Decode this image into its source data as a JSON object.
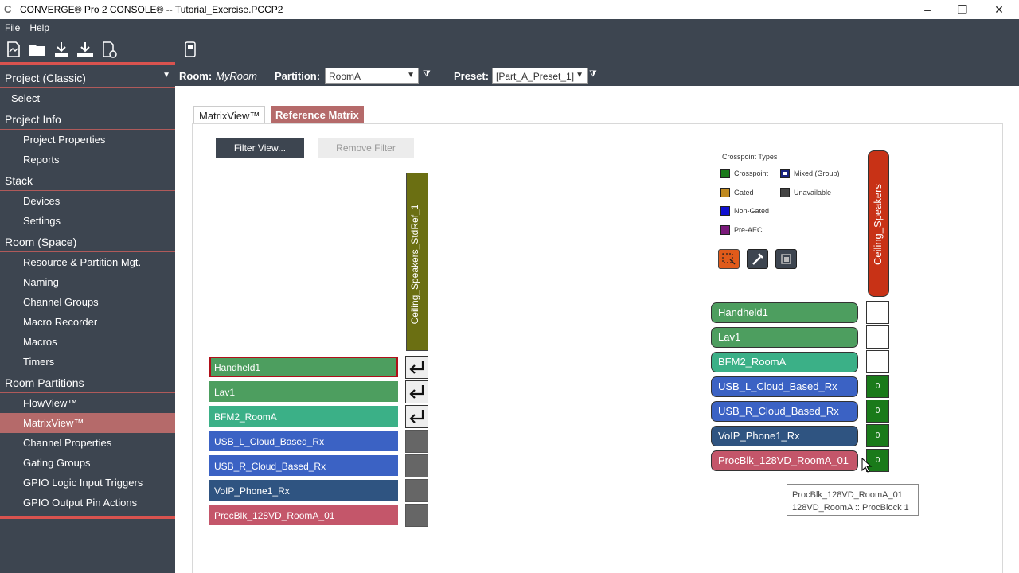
{
  "window": {
    "title": "CONVERGE® Pro 2 CONSOLE®  -- Tutorial_Exercise.PCCP2",
    "minimize": "–",
    "restore": "❐",
    "close": "✕"
  },
  "menu": {
    "file": "File",
    "help": "Help"
  },
  "toolbar_icons": [
    "new-project-icon",
    "open-folder-icon",
    "download-icon",
    "download-all-icon",
    "disconnect-icon",
    "device-icon"
  ],
  "sidebar": {
    "header": "Project (Classic)",
    "items": [
      {
        "type": "item",
        "label": "Select"
      },
      {
        "type": "head",
        "label": "Project Info"
      },
      {
        "type": "item",
        "label": "Project Properties"
      },
      {
        "type": "item",
        "label": "Reports"
      },
      {
        "type": "head",
        "label": "Stack"
      },
      {
        "type": "item",
        "label": "Devices"
      },
      {
        "type": "item",
        "label": "Settings"
      },
      {
        "type": "head",
        "label": "Room (Space)"
      },
      {
        "type": "item",
        "label": "Resource & Partition Mgt."
      },
      {
        "type": "item",
        "label": "Naming"
      },
      {
        "type": "item",
        "label": "Channel Groups"
      },
      {
        "type": "item",
        "label": "Macro Recorder"
      },
      {
        "type": "item",
        "label": "Macros"
      },
      {
        "type": "item",
        "label": "Timers"
      },
      {
        "type": "head",
        "label": "Room Partitions"
      },
      {
        "type": "item",
        "label": "FlowView™"
      },
      {
        "type": "item",
        "label": "MatrixView™",
        "selected": true
      },
      {
        "type": "item",
        "label": "Channel Properties"
      },
      {
        "type": "item",
        "label": "Gating Groups"
      },
      {
        "type": "item",
        "label": "GPIO Logic Input Triggers"
      },
      {
        "type": "item",
        "label": "GPIO Output Pin Actions"
      }
    ]
  },
  "header": {
    "room_label": "Room:",
    "room_value": "MyRoom",
    "partition_label": "Partition:",
    "partition_value": "RoomA",
    "preset_label": "Preset:",
    "preset_value": "[Part_A_Preset_1]"
  },
  "tabs": {
    "matrixview": "MatrixView™",
    "reference": "Reference Matrix"
  },
  "buttons": {
    "filter_view": "Filter View...",
    "remove_filter": "Remove Filter"
  },
  "left_matrix": {
    "column": "Ceiling_Speakers_StdRef_1",
    "rows": [
      {
        "label": "Handheld1",
        "color": "#4d9e5f",
        "routed": true,
        "selected": true
      },
      {
        "label": "Lav1",
        "color": "#4d9e5f",
        "routed": true
      },
      {
        "label": "BFM2_RoomA",
        "color": "#3bb087",
        "routed": true
      },
      {
        "label": "USB_L_Cloud_Based_Rx",
        "color": "#3b62c4",
        "routed": false
      },
      {
        "label": "USB_R_Cloud_Based_Rx",
        "color": "#3b62c4",
        "routed": false
      },
      {
        "label": "VoIP_Phone1_Rx",
        "color": "#2f5481",
        "routed": false
      },
      {
        "label": "ProcBlk_128VD_RoomA_01",
        "color": "#c4566a",
        "routed": false
      }
    ]
  },
  "legend": {
    "title": "Crosspoint Types",
    "items": [
      {
        "label": "Crosspoint",
        "color": "#1a7a1a"
      },
      {
        "label": "Mixed (Group)",
        "color": "#1a2580"
      },
      {
        "label": "Gated",
        "color": "#c08a20"
      },
      {
        "label": "Unavailable",
        "color": "#444444"
      },
      {
        "label": "Non-Gated",
        "color": "#1010d0"
      },
      {
        "label": "Pre-AEC",
        "color": "#7a1a7a"
      }
    ]
  },
  "right_matrix": {
    "column": "Ceiling_Speakers",
    "rows": [
      {
        "label": "Handheld1",
        "color": "#4d9e5f",
        "value": ""
      },
      {
        "label": "Lav1",
        "color": "#4d9e5f",
        "value": ""
      },
      {
        "label": "BFM2_RoomA",
        "color": "#3bb087",
        "value": ""
      },
      {
        "label": "USB_L_Cloud_Based_Rx",
        "color": "#3b62c4",
        "value": "0"
      },
      {
        "label": "USB_R_Cloud_Based_Rx",
        "color": "#3b62c4",
        "value": "0"
      },
      {
        "label": "VoIP_Phone1_Rx",
        "color": "#2f5481",
        "value": "0"
      },
      {
        "label": "ProcBlk_128VD_RoomA_01",
        "color": "#c4566a",
        "value": "0"
      }
    ]
  },
  "tooltip": {
    "line1": "ProcBlk_128VD_RoomA_01",
    "line2": "128VD_RoomA :: ProcBlock 1"
  }
}
